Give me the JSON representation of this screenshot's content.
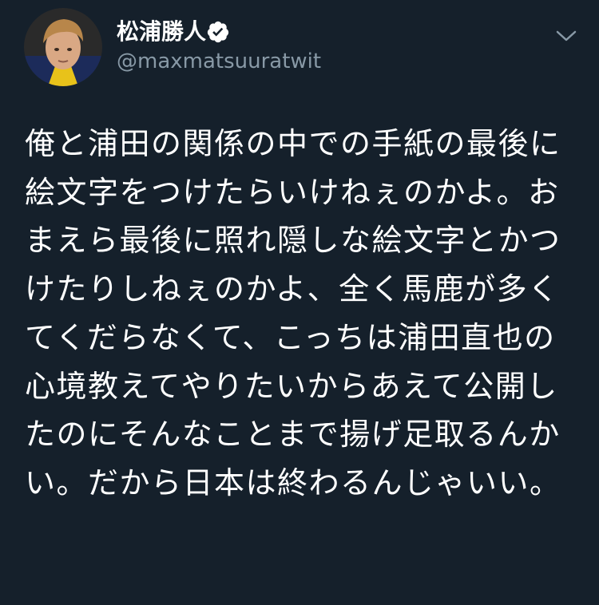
{
  "tweet": {
    "display_name": "松浦勝人",
    "handle": "@maxmatsuuratwit",
    "text": "俺と浦田の関係の中での手紙の最後に絵文字をつけたらいけねぇのかよ。おまえら最後に照れ隠しな絵文字とかつけたりしねぇのかよ、全く馬鹿が多くてくだらなくて、こっちは浦田直也の心境教えてやりたいからあえて公開したのにそんなことまで揚げ足取るんかい。だから日本は終わるんじゃいい。",
    "verified_icon": "verified-badge-icon",
    "menu_icon": "chevron-down-icon"
  },
  "colors": {
    "background": "#15202b",
    "text": "#ffffff",
    "secondary_text": "#8899a6"
  }
}
